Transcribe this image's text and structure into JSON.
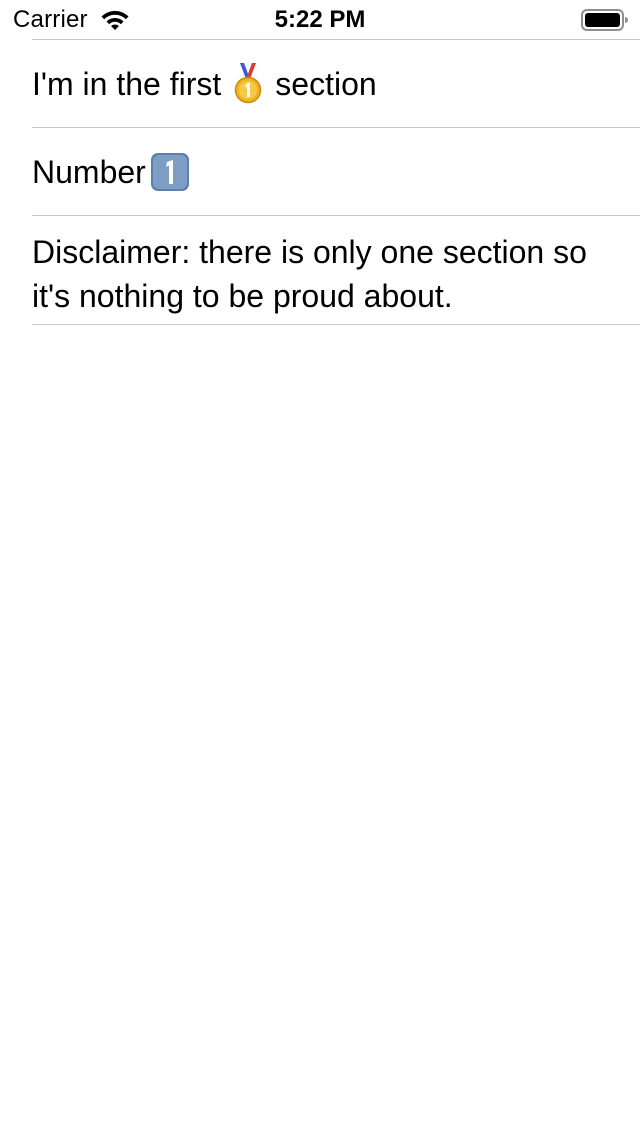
{
  "status_bar": {
    "carrier": "Carrier",
    "time": "5:22 PM",
    "icons": [
      "wifi-icon",
      "battery-icon"
    ]
  },
  "rows": [
    {
      "text_before": "I'm in the first",
      "icon": "first-place-medal-icon",
      "text_after": "section"
    },
    {
      "text_before": "Number",
      "icon": "keycap-one-icon"
    },
    {
      "text": "Disclaimer: there is only one section so it's nothing to be proud about."
    }
  ],
  "colors": {
    "separator": "#c8c7cc",
    "medal_gold": "#e8a317",
    "keycap_blue": "#6e8fb5"
  }
}
